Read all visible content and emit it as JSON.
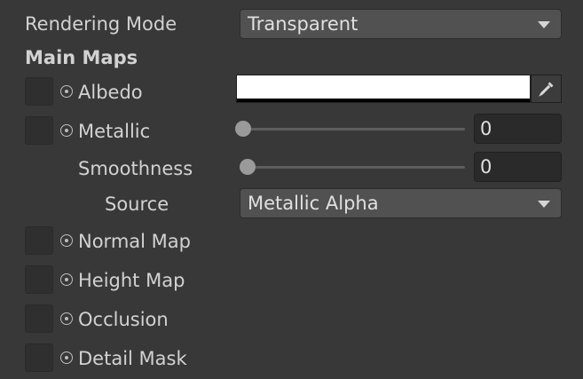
{
  "rendering_mode": {
    "label": "Rendering Mode",
    "value": "Transparent"
  },
  "section_title": "Main Maps",
  "albedo": {
    "label": "Albedo",
    "color": "#ffffff"
  },
  "metallic": {
    "label": "Metallic",
    "value": "0",
    "level": 0
  },
  "smoothness": {
    "label": "Smoothness",
    "value": "0",
    "level": 0
  },
  "source": {
    "label": "Source",
    "value": "Metallic Alpha"
  },
  "normal_map": {
    "label": "Normal Map"
  },
  "height_map": {
    "label": "Height Map"
  },
  "occlusion": {
    "label": "Occlusion"
  },
  "detail_mask": {
    "label": "Detail Mask"
  },
  "icons": {
    "texture_target": "target-icon",
    "dropdown": "chevron-down-icon",
    "picker": "eyedropper-icon"
  }
}
